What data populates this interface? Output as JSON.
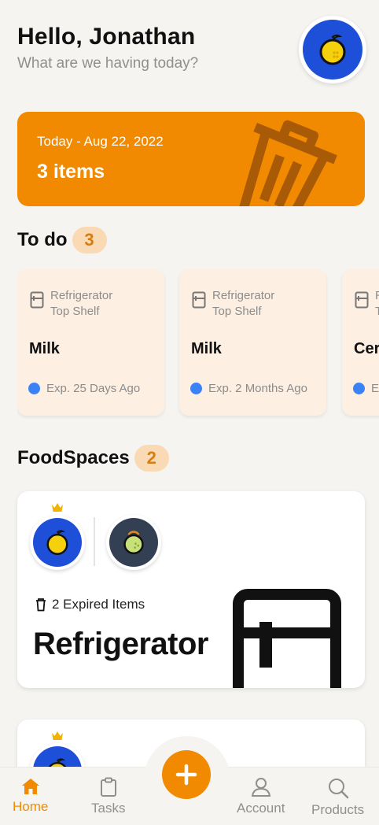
{
  "header": {
    "greeting": "Hello, Jonathan",
    "subtitle": "What are we having today?"
  },
  "banner": {
    "date": "Today - Aug 22, 2022",
    "count": "3 items",
    "icon": "trash-icon"
  },
  "todo": {
    "title": "To do",
    "count": "3",
    "items": [
      {
        "location": "Refrigerator",
        "sublocation": "Top Shelf",
        "name": "Milk",
        "expiry": "Exp. 25 Days Ago"
      },
      {
        "location": "Refrigerator",
        "sublocation": "Top Shelf",
        "name": "Milk",
        "expiry": "Exp. 2 Months Ago"
      },
      {
        "location": "R",
        "sublocation": "T",
        "name": "Cer",
        "expiry": "Ex"
      }
    ]
  },
  "foodspaces": {
    "title": "FoodSpaces",
    "count": "2",
    "cards": [
      {
        "expired": "2 Expired Items",
        "name": "Refrigerator"
      }
    ]
  },
  "tabbar": {
    "home": "Home",
    "tasks": "Tasks",
    "account": "Account",
    "products": "Products"
  },
  "colors": {
    "accent": "#f18a00",
    "avatar_blue": "#1d4fd8",
    "avatar_dark": "#333f52",
    "todo_card": "#fdefe2",
    "pill": "#fad9b5",
    "expiry_dot": "#3b82f6"
  }
}
